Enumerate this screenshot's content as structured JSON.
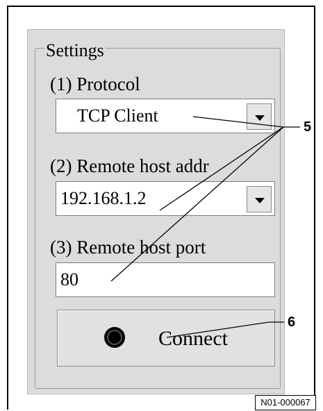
{
  "settings": {
    "title": "Settings",
    "protocol_label": "(1) Protocol",
    "protocol_value": "TCP Client",
    "remote_host_addr_label": "(2) Remote host addr",
    "remote_host_addr_value": "192.168.1.2",
    "remote_host_port_label": "(3) Remote host port",
    "remote_host_port_value": "80",
    "connect_label": "Connect"
  },
  "callouts": {
    "c5": "5",
    "c6": "6"
  },
  "image_code": "N01-000067",
  "icons": {
    "dropdown": "chevron-down-icon",
    "radio": "radio-selected-icon"
  }
}
